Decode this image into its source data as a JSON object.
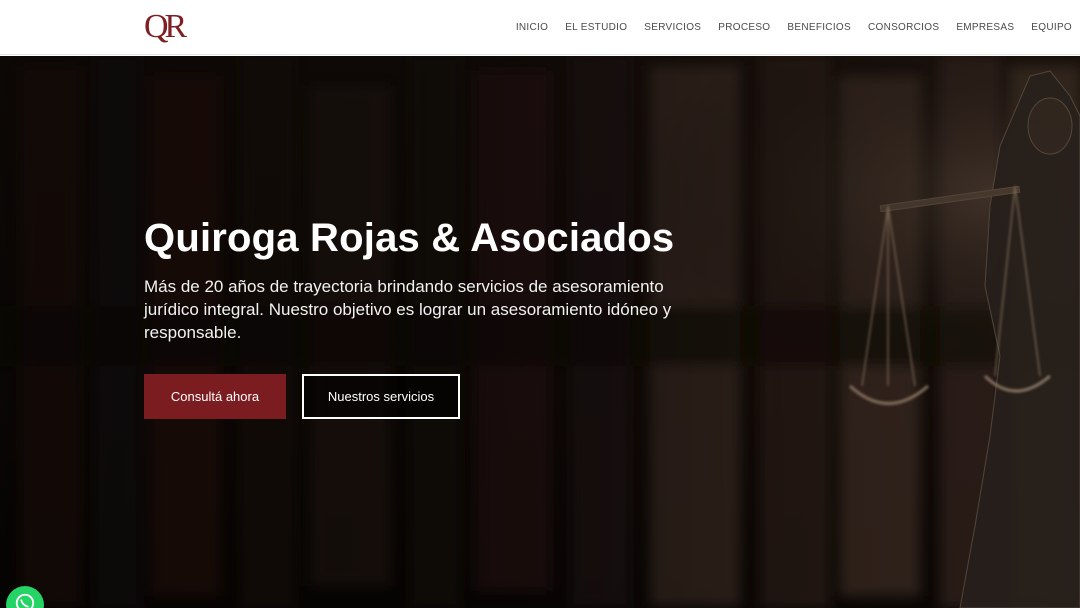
{
  "logo": {
    "text": "QR",
    "color": "#7e1f24"
  },
  "nav": {
    "items": [
      {
        "label": "INICIO"
      },
      {
        "label": "EL ESTUDIO"
      },
      {
        "label": "SERVICIOS"
      },
      {
        "label": "PROCESO"
      },
      {
        "label": "BENEFICIOS"
      },
      {
        "label": "CONSORCIOS"
      },
      {
        "label": "EMPRESAS"
      },
      {
        "label": "EQUIPO"
      }
    ]
  },
  "hero": {
    "title": "Quiroga Rojas & Asociados",
    "description": "Más de 20 años de trayectoria brindando servicios de asesoramiento jurídico integral. Nuestro objetivo es lograr un asesoramiento idóneo y responsable.",
    "primary_button": "Consultá ahora",
    "secondary_button": "Nuestros servicios",
    "background_icon": "justice-statue-scales-image"
  },
  "floating": {
    "icon": "whatsapp-icon"
  },
  "colors": {
    "brand": "#7b1c20",
    "nav_text": "#4a4a4a",
    "hero_text": "#ffffff",
    "whatsapp": "#25d366"
  }
}
